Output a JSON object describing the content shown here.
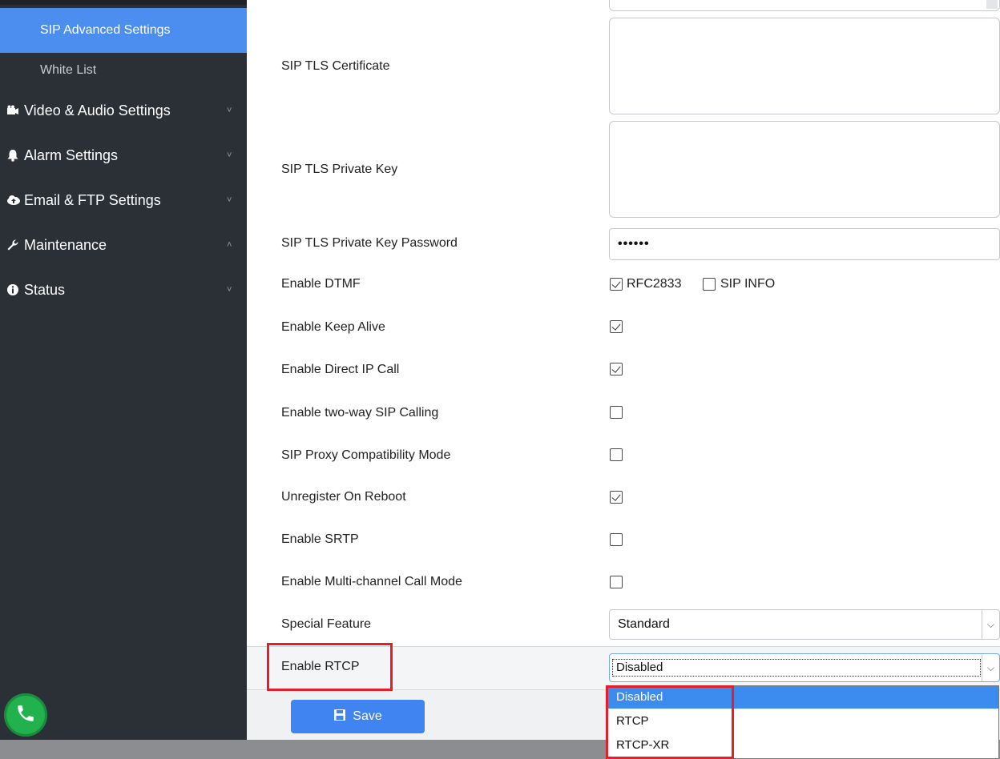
{
  "sidebar": {
    "sub_items": [
      {
        "label": "SIP Advanced Settings",
        "active": true
      },
      {
        "label": "White List",
        "active": false
      }
    ],
    "menu_items": [
      {
        "label": "Video & Audio Settings",
        "icon": "video-camera-icon",
        "chevron": "˅"
      },
      {
        "label": "Alarm Settings",
        "icon": "bell-icon",
        "chevron": "˅"
      },
      {
        "label": "Email & FTP Settings",
        "icon": "cloud-icon",
        "chevron": "˅"
      },
      {
        "label": "Maintenance",
        "icon": "wrench-icon",
        "chevron": "˄"
      },
      {
        "label": "Status",
        "icon": "info-icon",
        "chevron": "˅"
      }
    ],
    "phone_icon": "phone-icon",
    "colors": {
      "bg": "#2b2f36",
      "active": "#4c8df0"
    }
  },
  "form": {
    "sip_tls_certificate": {
      "label": "SIP TLS Certificate"
    },
    "sip_tls_private_key": {
      "label": "SIP TLS Private Key"
    },
    "sip_tls_private_key_password": {
      "label": "SIP TLS Private Key Password",
      "value": "••••••"
    },
    "enable_dtmf": {
      "label": "Enable DTMF",
      "options": [
        {
          "label": "RFC2833",
          "checked": true
        },
        {
          "label": "SIP INFO",
          "checked": false
        }
      ]
    },
    "enable_keep_alive": {
      "label": "Enable Keep Alive",
      "checked": true
    },
    "enable_direct_ip_call": {
      "label": "Enable Direct IP Call",
      "checked": true
    },
    "enable_two_way_sip_calling": {
      "label": "Enable two-way SIP Calling",
      "checked": false
    },
    "sip_proxy_compatibility_mode": {
      "label": "SIP Proxy Compatibility Mode",
      "checked": false
    },
    "unregister_on_reboot": {
      "label": "Unregister On Reboot",
      "checked": true
    },
    "enable_srtp": {
      "label": "Enable SRTP",
      "checked": false
    },
    "enable_multi_channel_call_mode": {
      "label": "Enable Multi-channel Call Mode",
      "checked": false
    },
    "special_feature": {
      "label": "Special Feature",
      "value": "Standard"
    },
    "enable_rtcp": {
      "label": "Enable RTCP",
      "value": "Disabled",
      "options": [
        "Disabled",
        "RTCP",
        "RTCP-XR"
      ],
      "highlighted_option": "Disabled"
    }
  },
  "footer": {
    "save_label": "Save",
    "save_icon": "floppy-disk-icon"
  },
  "colors": {
    "accent": "#3f84f1",
    "highlight": "#e2202a",
    "dropdown_selected": "#3c8cf0"
  }
}
